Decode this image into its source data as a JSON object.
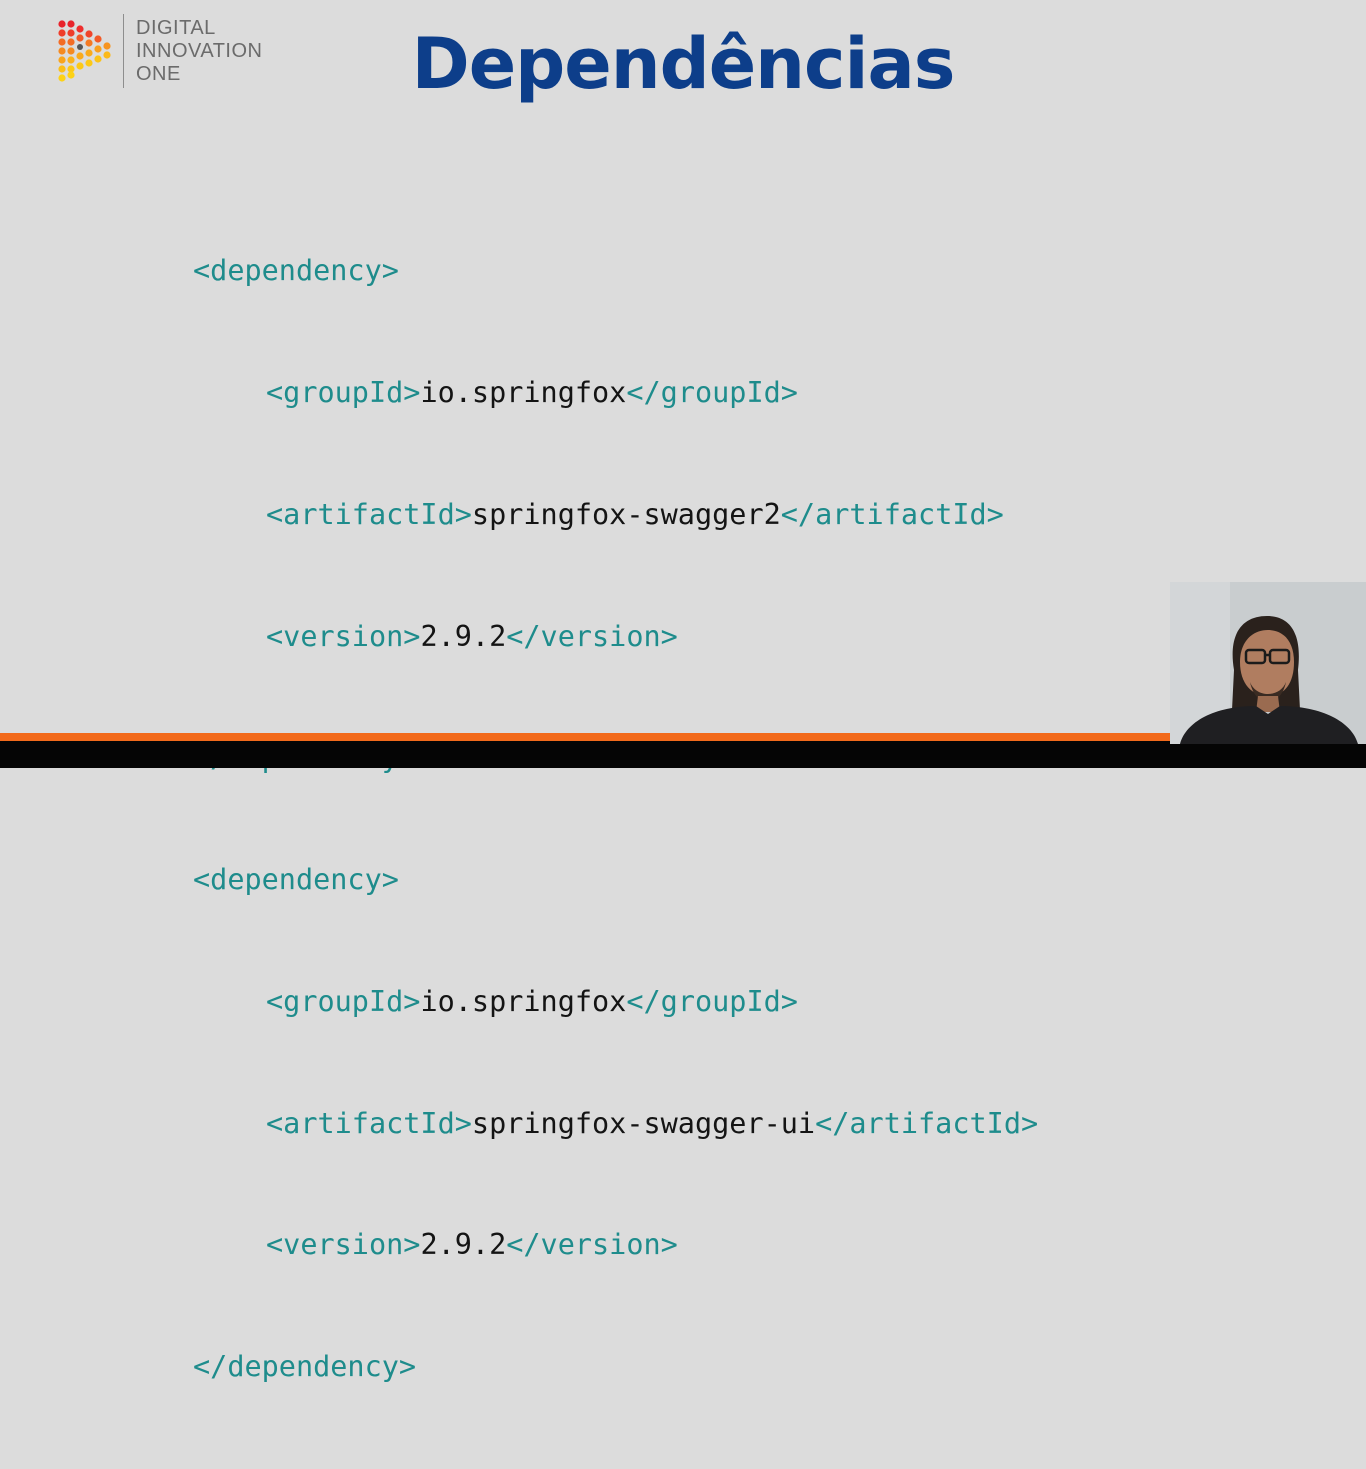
{
  "logo": {
    "lines": [
      "DIGITAL",
      "INNOVATION",
      "ONE"
    ],
    "icon": "dio-play-dots-icon"
  },
  "title": "Dependências",
  "code": {
    "dep1": {
      "open": "<dependency>",
      "group_open": "<groupId>",
      "group_val": "io.springfox",
      "group_close": "</groupId>",
      "artifact_open": "<artifactId>",
      "artifact_val": "springfox-swagger2",
      "artifact_close": "</artifactId>",
      "version_open": "<version>",
      "version_val": "2.9.2",
      "version_close": "</version>",
      "close": "</dependency>"
    },
    "dep2": {
      "open": "<dependency>",
      "group_open": "<groupId>",
      "group_val": "io.springfox",
      "group_close": "</groupId>",
      "artifact_open": "<artifactId>",
      "artifact_val": "springfox-swagger-ui",
      "artifact_close": "</artifactId>",
      "version_open": "<version>",
      "version_val": "2.9.2",
      "version_close": "</version>",
      "close": "</dependency>"
    }
  },
  "colors": {
    "title": "#0d3e8a",
    "tag": "#1e8c8c",
    "accent_bar": "#f26a1b"
  }
}
